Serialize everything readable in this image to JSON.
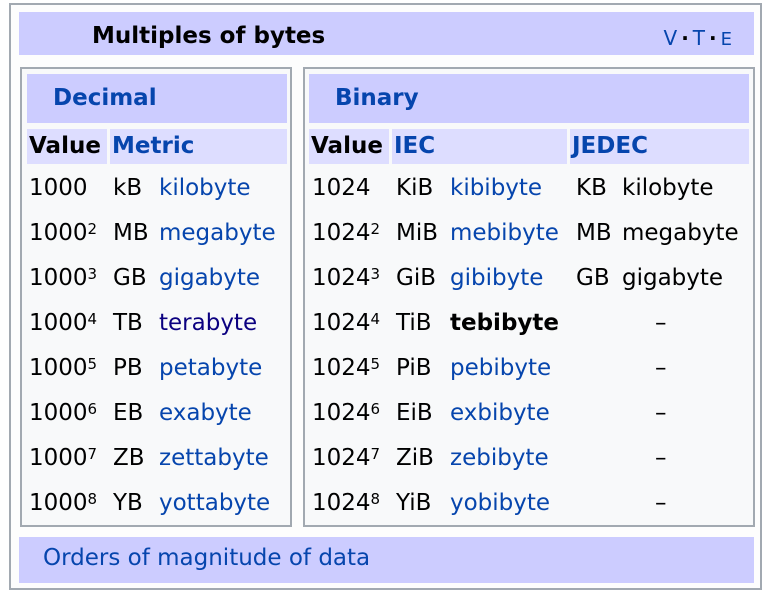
{
  "navbox": {
    "title": "Multiples of bytes",
    "vte": [
      "V",
      "T",
      "E"
    ]
  },
  "decimal": {
    "heading": "Decimal",
    "columns": {
      "value": "Value",
      "metric": "Metric"
    },
    "rows": [
      {
        "base": "1000",
        "exp": "",
        "symbol": "kB",
        "name": "kilobyte"
      },
      {
        "base": "1000",
        "exp": "2",
        "symbol": "MB",
        "name": "megabyte"
      },
      {
        "base": "1000",
        "exp": "3",
        "symbol": "GB",
        "name": "gigabyte"
      },
      {
        "base": "1000",
        "exp": "4",
        "symbol": "TB",
        "name": "terabyte"
      },
      {
        "base": "1000",
        "exp": "5",
        "symbol": "PB",
        "name": "petabyte"
      },
      {
        "base": "1000",
        "exp": "6",
        "symbol": "EB",
        "name": "exabyte"
      },
      {
        "base": "1000",
        "exp": "7",
        "symbol": "ZB",
        "name": "zettabyte"
      },
      {
        "base": "1000",
        "exp": "8",
        "symbol": "YB",
        "name": "yottabyte"
      }
    ]
  },
  "binary": {
    "heading": "Binary",
    "columns": {
      "value": "Value",
      "iec": "IEC",
      "jedec": "JEDEC"
    },
    "rows": [
      {
        "base": "1024",
        "exp": "",
        "symbol": "KiB",
        "name": "kibibyte",
        "jedec_symbol": "KB",
        "jedec_name": "kilobyte"
      },
      {
        "base": "1024",
        "exp": "2",
        "symbol": "MiB",
        "name": "mebibyte",
        "jedec_symbol": "MB",
        "jedec_name": "megabyte"
      },
      {
        "base": "1024",
        "exp": "3",
        "symbol": "GiB",
        "name": "gibibyte",
        "jedec_symbol": "GB",
        "jedec_name": "gigabyte"
      },
      {
        "base": "1024",
        "exp": "4",
        "symbol": "TiB",
        "name": "tebibyte",
        "jedec_dash": "–"
      },
      {
        "base": "1024",
        "exp": "5",
        "symbol": "PiB",
        "name": "pebibyte",
        "jedec_dash": "–"
      },
      {
        "base": "1024",
        "exp": "6",
        "symbol": "EiB",
        "name": "exbibyte",
        "jedec_dash": "–"
      },
      {
        "base": "1024",
        "exp": "7",
        "symbol": "ZiB",
        "name": "zebibyte",
        "jedec_dash": "–"
      },
      {
        "base": "1024",
        "exp": "8",
        "symbol": "YiB",
        "name": "yobibyte",
        "jedec_dash": "–"
      }
    ]
  },
  "footer": {
    "link": "Orders of magnitude of data"
  },
  "colors": {
    "header_bg": "#ccccff",
    "subheader_bg": "#ddddff",
    "link": "#0645ad",
    "visited_link": "#0b0080",
    "border": "#a2a9b1"
  }
}
